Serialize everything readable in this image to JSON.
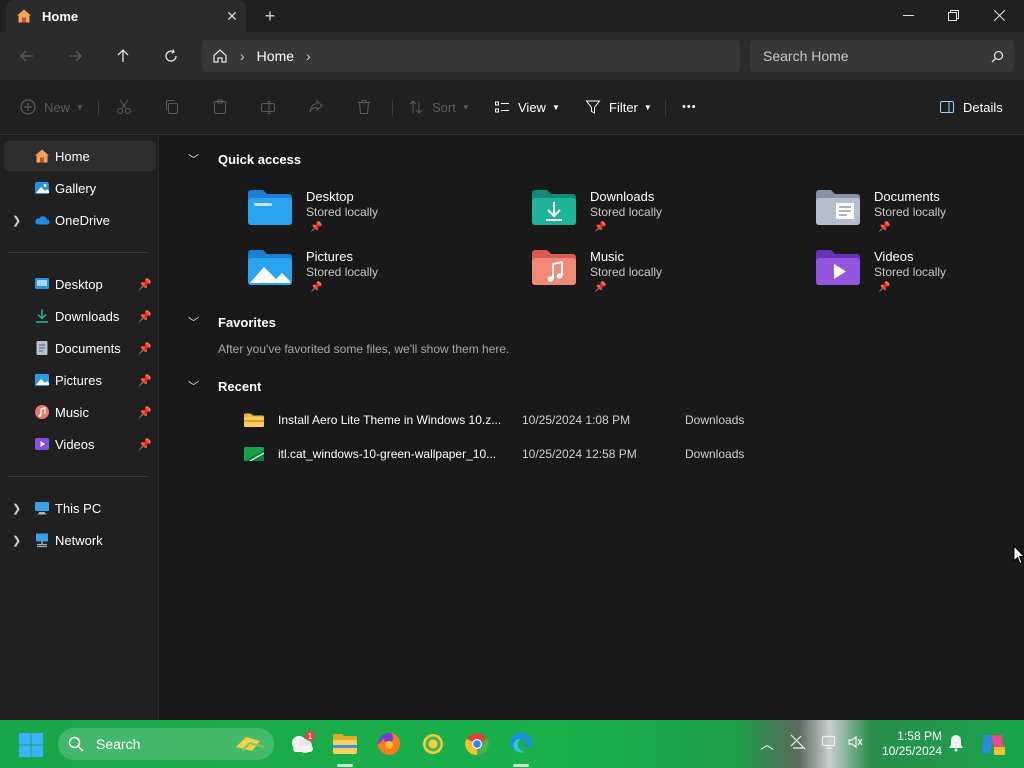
{
  "window": {
    "tab_title": "Home",
    "new_tab_symbol": "+"
  },
  "address": {
    "crumb": "Home",
    "search_placeholder": "Search Home"
  },
  "commands": {
    "new": "New",
    "sort": "Sort",
    "view": "View",
    "filter": "Filter",
    "more": "•••",
    "details": "Details"
  },
  "sidebar": {
    "top": [
      {
        "label": "Home",
        "icon": "home-icon"
      },
      {
        "label": "Gallery",
        "icon": "gallery-icon"
      },
      {
        "label": "OneDrive",
        "icon": "onedrive-icon"
      }
    ],
    "pinned": [
      {
        "label": "Desktop",
        "icon": "desktop-folder-icon"
      },
      {
        "label": "Downloads",
        "icon": "downloads-folder-icon"
      },
      {
        "label": "Documents",
        "icon": "documents-folder-icon"
      },
      {
        "label": "Pictures",
        "icon": "pictures-folder-icon"
      },
      {
        "label": "Music",
        "icon": "music-folder-icon"
      },
      {
        "label": "Videos",
        "icon": "videos-folder-icon"
      }
    ],
    "bottom": [
      {
        "label": "This PC",
        "icon": "this-pc-icon"
      },
      {
        "label": "Network",
        "icon": "network-icon"
      }
    ]
  },
  "quick_access": {
    "title": "Quick access",
    "items": [
      {
        "name": "Desktop",
        "status": "Stored locally",
        "color": "#1c8fd6"
      },
      {
        "name": "Downloads",
        "status": "Stored locally",
        "color": "#1aa28a"
      },
      {
        "name": "Documents",
        "status": "Stored locally",
        "color": "#a9b4c2"
      },
      {
        "name": "Pictures",
        "status": "Stored locally",
        "color": "#2b9be6"
      },
      {
        "name": "Music",
        "status": "Stored locally",
        "color": "#e8786a"
      },
      {
        "name": "Videos",
        "status": "Stored locally",
        "color": "#8a4fd8"
      }
    ]
  },
  "favorites": {
    "title": "Favorites",
    "empty_text": "After you've favorited some files, we'll show them here."
  },
  "recent": {
    "title": "Recent",
    "rows": [
      {
        "name": "Install Aero Lite Theme in Windows 10.z...",
        "date": "10/25/2024 1:08 PM",
        "location": "Downloads",
        "icon": "zip-folder-icon"
      },
      {
        "name": "itl.cat_windows-10-green-wallpaper_10...",
        "date": "10/25/2024 12:58 PM",
        "location": "Downloads",
        "icon": "image-file-icon"
      }
    ]
  },
  "taskbar": {
    "search_label": "Search",
    "badge_count": "1",
    "time": "1:58 PM",
    "date": "10/25/2024"
  },
  "colors": {
    "window_bg": "#191919",
    "chrome_bg": "#202020",
    "address_bg": "#2b2b2b",
    "taskbar_green": "#19b24b"
  }
}
